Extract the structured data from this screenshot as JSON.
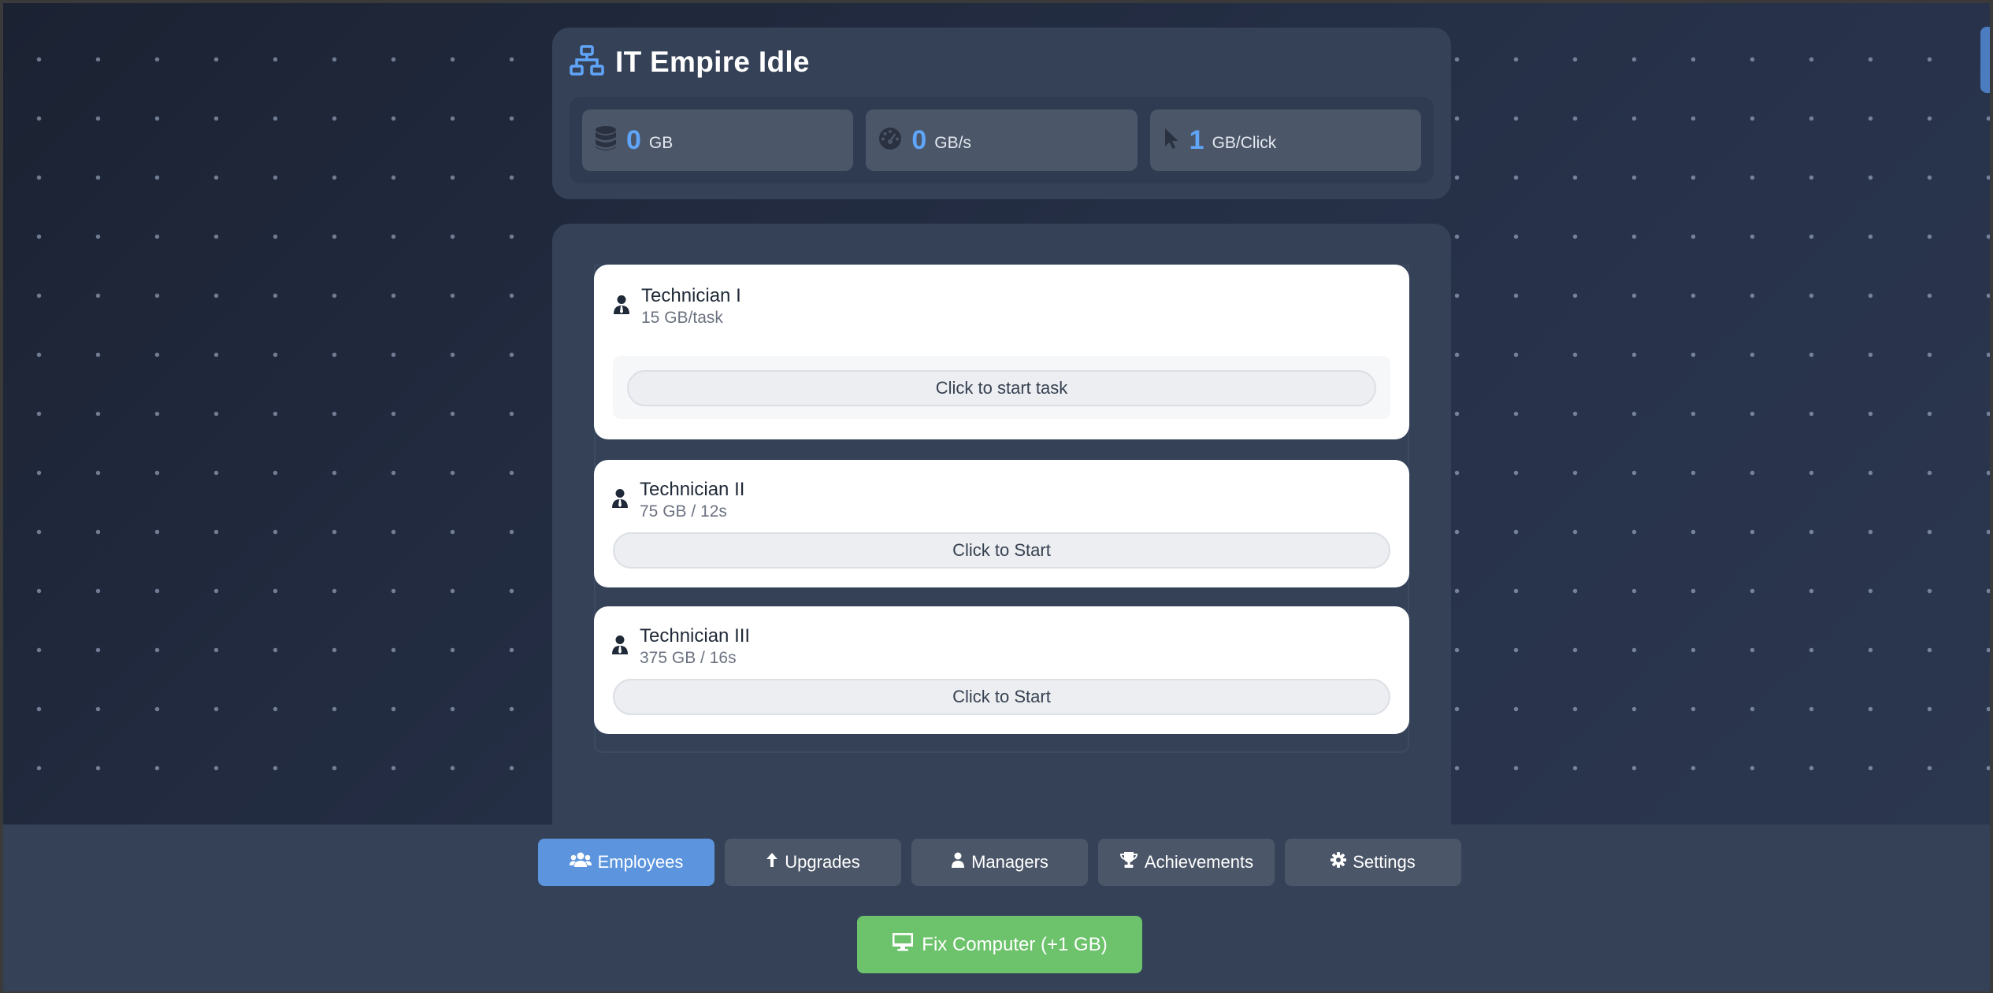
{
  "app": {
    "title": "IT Empire Idle",
    "logo_icon": "network-icon"
  },
  "stats": [
    {
      "icon": "database-icon",
      "value": "0",
      "unit": "GB"
    },
    {
      "icon": "gauge-icon",
      "value": "0",
      "unit": "GB/s"
    },
    {
      "icon": "pointer-icon",
      "value": "1",
      "unit": "GB/Click"
    }
  ],
  "employees": [
    {
      "name": "Technician I",
      "rate": "15 GB/task",
      "action": "Click to start task",
      "icon": "user-tie-icon"
    },
    {
      "name": "Technician II",
      "rate": "75 GB / 12s",
      "action": "Click to Start",
      "icon": "user-tie-icon"
    },
    {
      "name": "Technician III",
      "rate": "375 GB / 16s",
      "action": "Click to Start",
      "icon": "user-tie-icon"
    }
  ],
  "tabs": [
    {
      "label": "Employees",
      "icon": "users-icon",
      "active": true
    },
    {
      "label": "Upgrades",
      "icon": "arrow-up-icon",
      "active": false
    },
    {
      "label": "Managers",
      "icon": "user-icon",
      "active": false
    },
    {
      "label": "Achievements",
      "icon": "trophy-icon",
      "active": false
    },
    {
      "label": "Settings",
      "icon": "gear-icon",
      "active": false
    }
  ],
  "fix_button": {
    "label": "Fix Computer (+1 GB)",
    "icon": "desktop-icon"
  },
  "colors": {
    "accent_blue": "#60a5fa",
    "active_tab": "#5c95de",
    "fix_green": "#6cc36c",
    "panel": "#344157"
  }
}
